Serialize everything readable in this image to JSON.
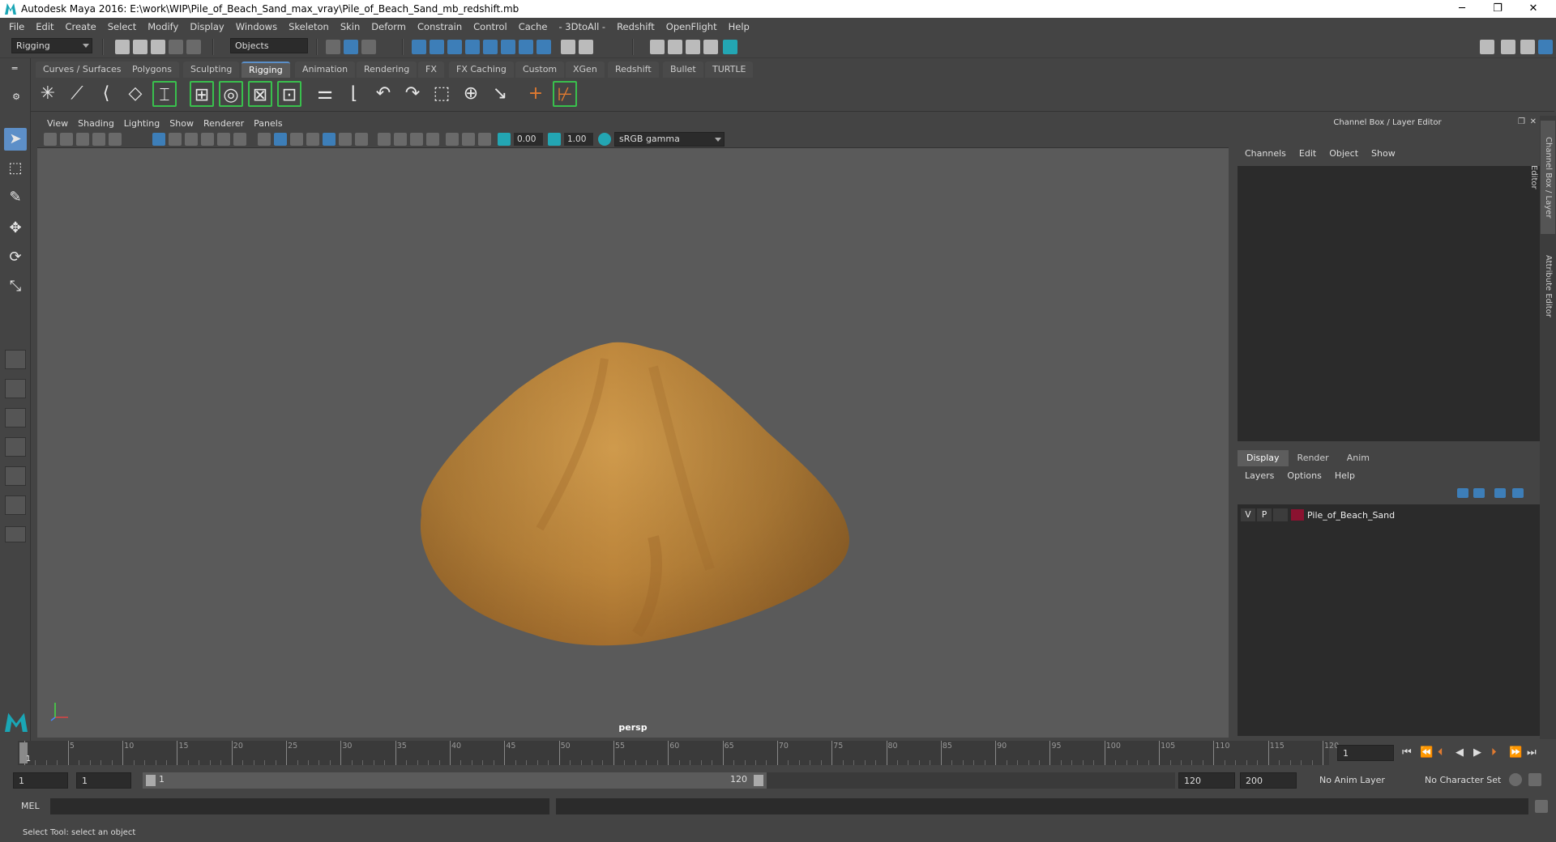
{
  "window": {
    "title": "Autodesk Maya 2016: E:\\work\\WIP\\Pile_of_Beach_Sand_max_vray\\Pile_of_Beach_Sand_mb_redshift.mb",
    "minimize": "─",
    "restore": "❐",
    "close": "✕"
  },
  "menubar": [
    "File",
    "Edit",
    "Create",
    "Select",
    "Modify",
    "Display",
    "Windows",
    "Skeleton",
    "Skin",
    "Deform",
    "Constrain",
    "Control",
    "Cache",
    "- 3DtoAll -",
    "Redshift",
    "OpenFlight",
    "Help"
  ],
  "statusline": {
    "menuset": "Rigging",
    "selection_mode": "Objects"
  },
  "shelf_tabs": [
    "Curves / Surfaces",
    "Polygons",
    "Sculpting",
    "Rigging",
    "Animation",
    "Rendering",
    "FX",
    "FX Caching",
    "Custom",
    "XGen",
    "Redshift",
    "Bullet",
    "TURTLE"
  ],
  "shelf_active_tab": "Rigging",
  "viewport": {
    "menu": [
      "View",
      "Shading",
      "Lighting",
      "Show",
      "Renderer",
      "Panels"
    ],
    "exposure": "0.00",
    "gamma": "1.00",
    "color_space": "sRGB gamma",
    "camera": "persp"
  },
  "channel_box": {
    "header": "Channel Box / Layer Editor",
    "menu": [
      "Channels",
      "Edit",
      "Object",
      "Show"
    ]
  },
  "layer_editor": {
    "tabs": [
      "Display",
      "Render",
      "Anim"
    ],
    "menu": [
      "Layers",
      "Options",
      "Help"
    ],
    "layers": [
      {
        "visible": "V",
        "playback": "P",
        "name": "Pile_of_Beach_Sand",
        "color": "#8a1230"
      }
    ]
  },
  "side_tabs": [
    "Channel Box / Layer Editor",
    "Attribute Editor"
  ],
  "timeline": {
    "ticks": [
      1,
      5,
      10,
      15,
      20,
      25,
      30,
      35,
      40,
      45,
      50,
      55,
      60,
      65,
      70,
      75,
      80,
      85,
      90,
      95,
      100,
      105,
      110,
      115,
      120
    ],
    "start": 1,
    "end": 120,
    "current_frame": "1"
  },
  "range": {
    "start_frame": "1",
    "playback_start": "1",
    "range_start": "1",
    "range_end": "120",
    "playback_end": "120",
    "end_frame": "200",
    "anim_layer": "No Anim Layer",
    "character_set": "No Character Set"
  },
  "command_line": {
    "label": "MEL"
  },
  "help_line": "Select Tool: select an object",
  "colors": {
    "sand": "#c08a3e",
    "accent": "#5d8fc8",
    "layer_color": "#8a1230"
  }
}
